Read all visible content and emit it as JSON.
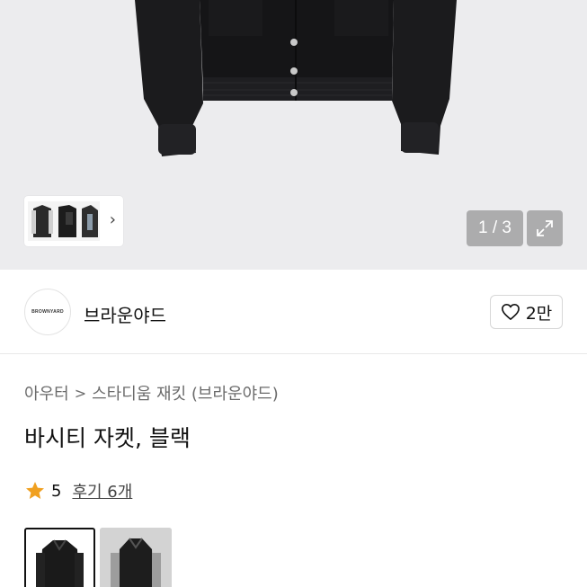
{
  "gallery": {
    "pager_text": "1 / 3",
    "thumbnail_next_icon": "chevron-right-icon",
    "expand_icon": "expand-arrows-icon"
  },
  "brand": {
    "logo_text": "BROWNYARD",
    "name": "브라운야드",
    "like_count": "2만",
    "like_icon": "heart-outline-icon"
  },
  "breadcrumb": {
    "category": "아우터",
    "separator": ">",
    "subcategory": "스타디움 재킷 (브라운야드)"
  },
  "product": {
    "title": "바시티 자켓, 블랙"
  },
  "rating": {
    "star_icon": "star-icon",
    "star_color": "#f0a020",
    "score": "5",
    "reviews_label": "후기 6개"
  },
  "variants": [
    {
      "name": "black-leather-sleeve",
      "selected": true
    },
    {
      "name": "black-gray-sleeve",
      "selected": false
    }
  ]
}
